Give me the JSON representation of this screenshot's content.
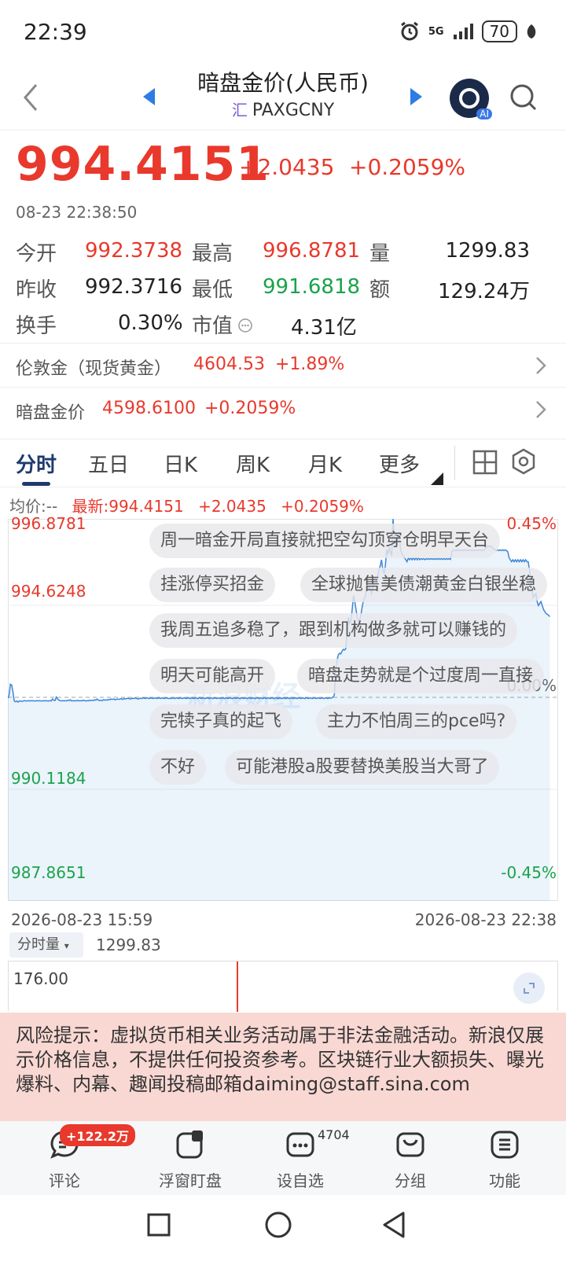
{
  "status_bar": {
    "time": "22:39",
    "network": "5G",
    "battery": "70"
  },
  "nav": {
    "title": "暗盘金价(人民币)",
    "subtitle_icon": "汇",
    "symbol": "PAXGCNY",
    "ai_badge": "AI"
  },
  "quote": {
    "price": "994.4151",
    "change": "+2.0435",
    "change_pct": "+0.2059%",
    "timestamp": "08-23 22:38:50"
  },
  "stats": {
    "open_label": "今开",
    "open": "992.3738",
    "high_label": "最高",
    "high": "996.8781",
    "volume_label": "量",
    "volume": "1299.83",
    "prev_close_label": "昨收",
    "prev_close": "992.3716",
    "low_label": "最低",
    "low": "991.6818",
    "amount_label": "额",
    "amount": "129.24万",
    "turnover_label": "换手",
    "turnover": "0.30%",
    "mcap_label": "市值",
    "mcap": "4.31亿"
  },
  "related": [
    {
      "label": "伦敦金（现货黄金）",
      "value": "4604.53",
      "change": "+1.89%"
    },
    {
      "label": "暗盘金价",
      "value": "4598.6100",
      "change": "+0.2059%"
    }
  ],
  "tabs": [
    "分时",
    "五日",
    "日K",
    "周K",
    "月K",
    "更多"
  ],
  "chart_header": {
    "avg": "均价:--",
    "latest": "最新:994.4151",
    "change": "+2.0435",
    "change_pct": "+0.2059%"
  },
  "chart_data": {
    "type": "line",
    "y_ticks_left": [
      "996.8781",
      "994.6248",
      "990.1184",
      "987.8651"
    ],
    "y_ticks_right": [
      "0.45%",
      "0.00%",
      "-0.45%"
    ],
    "ylim": [
      987.8651,
      996.8781
    ],
    "baseline": 992.3716,
    "x_start": "2026-08-23 15:59",
    "x_end": "2026-08-23 22:38",
    "series": [
      {
        "values": [
          992.37,
          992.45,
          992.72,
          992.7,
          992.52,
          992.3,
          992.28,
          992.3,
          992.27,
          992.3,
          992.3,
          992.29,
          992.3,
          992.31,
          992.3,
          992.3,
          992.31,
          992.3,
          992.31,
          992.3,
          992.31,
          992.3,
          992.3,
          992.31,
          992.3,
          992.31,
          992.3,
          992.3,
          992.31,
          992.3,
          992.31,
          992.3,
          992.3,
          992.31,
          992.3,
          992.35,
          992.32,
          992.31,
          992.4,
          992.35,
          992.32,
          992.31,
          992.3,
          992.31,
          992.3,
          992.31,
          992.3,
          992.32,
          992.31,
          992.33,
          992.3,
          992.31,
          992.3,
          992.31,
          992.3,
          992.32,
          992.3,
          992.31,
          992.3,
          992.32,
          992.31,
          992.3,
          992.31,
          992.3,
          992.32,
          992.31,
          992.32,
          992.31,
          992.33,
          992.32,
          992.35,
          992.32,
          992.31,
          992.32,
          992.31,
          992.33,
          992.32,
          992.33,
          992.32,
          992.34,
          992.33,
          992.35,
          992.34,
          992.35,
          992.33,
          992.34,
          992.35,
          992.34,
          992.35,
          992.36,
          992.34,
          992.36,
          992.35,
          992.36,
          992.37,
          992.36,
          992.35,
          992.36,
          992.37,
          992.36,
          992.38,
          992.36,
          992.35,
          992.36,
          992.37,
          992.36,
          992.38,
          992.37,
          992.36,
          992.38,
          992.37,
          992.36,
          992.38,
          992.37,
          992.36,
          992.38,
          992.37,
          992.36,
          992.38,
          992.37,
          992.36,
          992.38,
          992.37,
          992.36,
          992.38,
          992.37,
          992.36,
          992.37,
          992.36,
          992.38,
          992.37,
          992.36,
          992.38,
          992.37,
          992.36,
          992.38,
          992.37,
          992.36,
          992.38,
          992.37,
          992.36,
          992.38,
          992.37,
          992.36,
          992.38,
          992.37,
          992.36,
          992.38,
          992.37,
          992.36,
          992.38,
          992.37,
          992.36,
          992.38,
          992.37,
          992.36,
          992.38,
          992.37,
          992.36,
          992.38,
          992.37,
          992.36,
          992.38,
          992.37,
          992.36,
          992.38,
          992.37,
          992.36,
          992.38,
          992.37,
          992.36,
          992.38,
          992.37,
          992.36,
          992.38,
          992.37,
          992.36,
          992.38,
          992.37,
          992.36,
          992.38,
          992.37,
          992.36,
          992.38,
          992.37,
          992.36,
          992.38,
          992.37,
          992.36,
          992.38,
          992.37,
          992.36,
          992.38,
          992.37,
          992.36,
          992.38,
          992.37,
          992.36,
          992.38,
          992.37,
          992.36,
          992.38,
          992.37,
          992.36,
          992.38,
          992.37,
          992.36,
          992.38,
          992.37,
          992.36,
          992.38,
          992.37,
          992.36,
          992.38,
          992.37,
          992.36,
          992.38,
          992.37,
          992.36,
          992.38,
          992.37,
          992.36,
          992.38,
          992.37,
          992.36,
          992.38,
          992.37,
          992.36,
          992.38,
          992.37,
          992.36,
          992.38,
          992.37,
          992.36,
          992.38,
          992.37,
          992.36,
          992.38,
          992.37,
          992.36,
          992.38,
          992.37,
          992.36,
          992.38,
          992.37,
          992.36,
          992.38,
          992.37,
          992.36,
          992.38,
          992.37,
          992.36,
          992.38,
          992.37,
          992.38,
          992.4,
          992.45,
          993.1,
          993.3,
          993.45,
          993.5,
          993.48,
          993.55,
          993.6,
          993.58,
          993.62,
          994.1,
          994.4,
          994.25,
          994.3,
          994.6,
          994.95,
          994.8,
          994.6,
          994.4,
          994.3,
          994.35,
          994.5,
          994.7,
          994.85,
          994.9,
          995.05,
          995.2,
          995.1,
          995.15,
          995.0,
          995.1,
          995.35,
          995.4,
          995.3,
          995.45,
          995.6,
          995.7,
          995.85,
          995.6,
          995.5,
          995.7,
          996.1,
          996.0,
          996.15,
          996.05,
          995.95,
          996.88,
          996.4,
          996.3,
          996.2,
          996.5,
          996.4,
          996.1,
          996.0,
          995.95,
          995.9,
          995.85,
          995.8,
          995.9,
          995.85,
          995.9,
          995.85,
          995.9,
          995.85,
          995.9,
          995.85,
          995.9,
          995.85,
          995.88,
          995.86,
          995.88,
          995.85,
          995.88,
          995.86,
          995.88,
          995.86,
          995.88,
          995.86,
          995.88,
          995.86,
          995.88,
          995.86,
          995.88,
          995.86,
          995.88,
          995.86,
          995.88,
          995.86,
          995.88,
          995.86,
          995.88,
          995.86,
          996.05,
          996.08,
          996.1,
          996.08,
          996.1,
          996.08,
          996.1,
          996.08,
          996.1,
          996.08,
          996.1,
          996.08,
          996.1,
          996.08,
          996.1,
          996.08,
          996.1,
          996.08,
          996.1,
          996.08,
          996.1,
          996.08,
          996.1,
          996.08,
          996.1,
          996.08,
          996.12,
          996.15,
          996.2,
          996.18,
          996.2,
          996.18,
          996.15,
          996.12,
          996.1,
          996.08,
          996.1,
          996.08,
          996.1,
          996.08,
          996.1,
          996.08,
          996.1,
          996.08,
          996.05,
          995.9,
          995.85,
          995.8,
          995.85,
          995.8,
          995.85,
          995.8,
          995.85,
          995.8,
          995.85,
          995.8,
          995.85,
          995.8,
          995.85,
          995.8,
          995.8,
          995.6,
          995.3,
          995.1,
          994.9,
          994.95,
          995.0,
          994.8,
          994.7,
          994.75,
          994.8,
          994.7,
          994.6,
          994.55,
          994.5,
          994.48,
          994.45,
          994.42
        ]
      }
    ]
  },
  "danmu": [
    "周一暗金开局直接就把空勾顶穿仓明早天台",
    "挂涨停买招金",
    "全球抛售美债潮黄金白银坐稳",
    "我周五追多稳了，跟到机构做多就可以赚钱的",
    "明天可能高开",
    "暗盘走势就是个过度周一直接",
    "完犊子真的起飞",
    "主力不怕周三的pce吗?",
    "不好",
    "可能港股a股要替换美股当大哥了"
  ],
  "watermark": "新浪财经",
  "volume": {
    "selector": "分时量",
    "value": "1299.83",
    "max": "176.00"
  },
  "risk_notice": "风险提示：虚拟货币相关业务活动属于非法金融活动。新浪仅展示价格信息，不提供任何投资参考。区块链行业大额损失、曝光爆料、内幕、趣闻投稿邮箱daiming@staff.sina.com",
  "bottom_bar": {
    "comments_label": "评论",
    "comments_badge": "+122.2万",
    "float_label": "浮窗盯盘",
    "watchlist_label": "设自选",
    "watchlist_count": "4704",
    "group_label": "分组",
    "func_label": "功能"
  },
  "colors": {
    "up": "#e8392c",
    "down": "#1aa34a",
    "line": "#3d86d8",
    "accent": "#1e3a6e"
  }
}
